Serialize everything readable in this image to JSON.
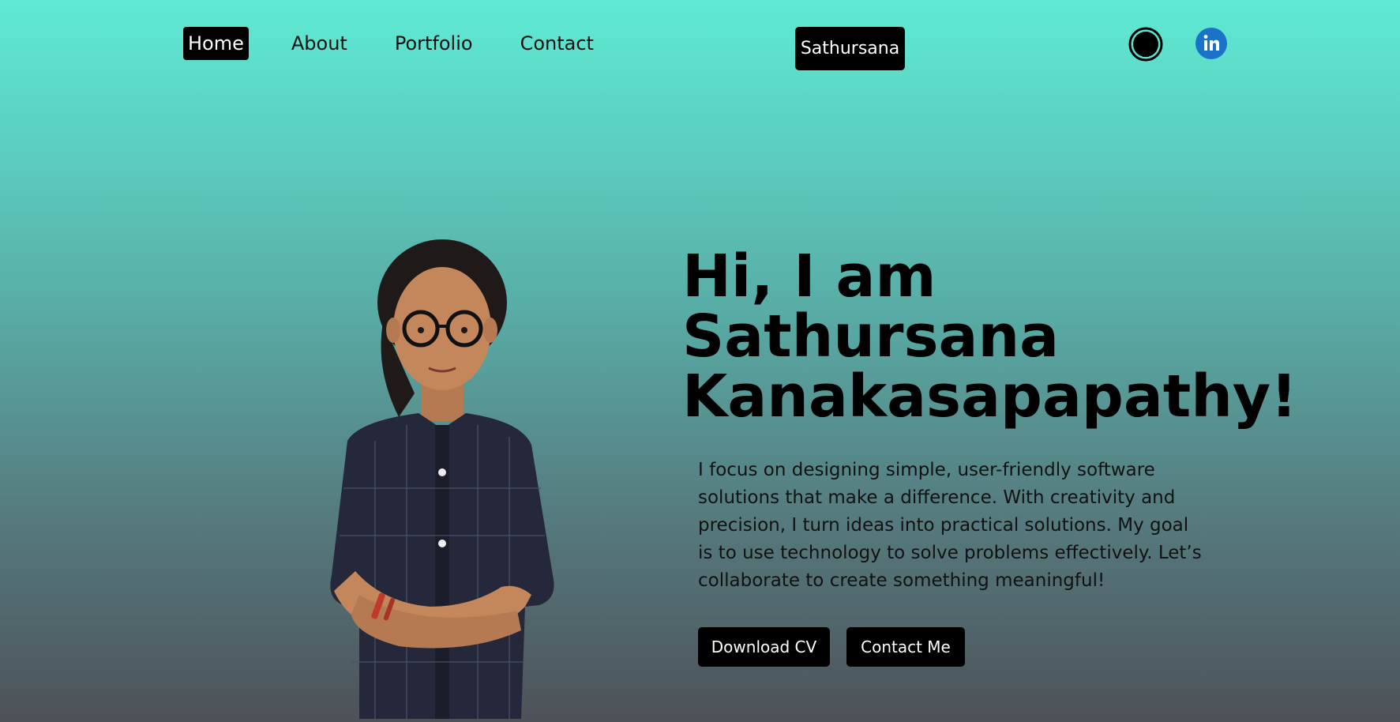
{
  "nav": {
    "items": [
      {
        "label": "Home",
        "active": true
      },
      {
        "label": "About",
        "active": false
      },
      {
        "label": "Portfolio",
        "active": false
      },
      {
        "label": "Contact",
        "active": false
      }
    ]
  },
  "brand": {
    "label": "Sathursana"
  },
  "social": [
    {
      "icon": "github-icon"
    },
    {
      "icon": "linkedin-icon",
      "color": "#1a73c8"
    }
  ],
  "hero": {
    "title_lines": [
      "Hi, I am",
      "Sathursana",
      "Kanakasapapathy!"
    ],
    "description": "I focus on designing simple, user-friendly software solutions that make a difference. With creativity and precision, I turn ideas into practical solutions. My goal is to use technology to solve problems effectively. Let’s collaborate to create something meaningful!",
    "buttons": {
      "download_cv": "Download CV",
      "contact_me": "Contact Me"
    }
  },
  "colors": {
    "gradient_top": "#5eead4",
    "gradient_bottom": "#4d5258",
    "accent": "#000000"
  }
}
